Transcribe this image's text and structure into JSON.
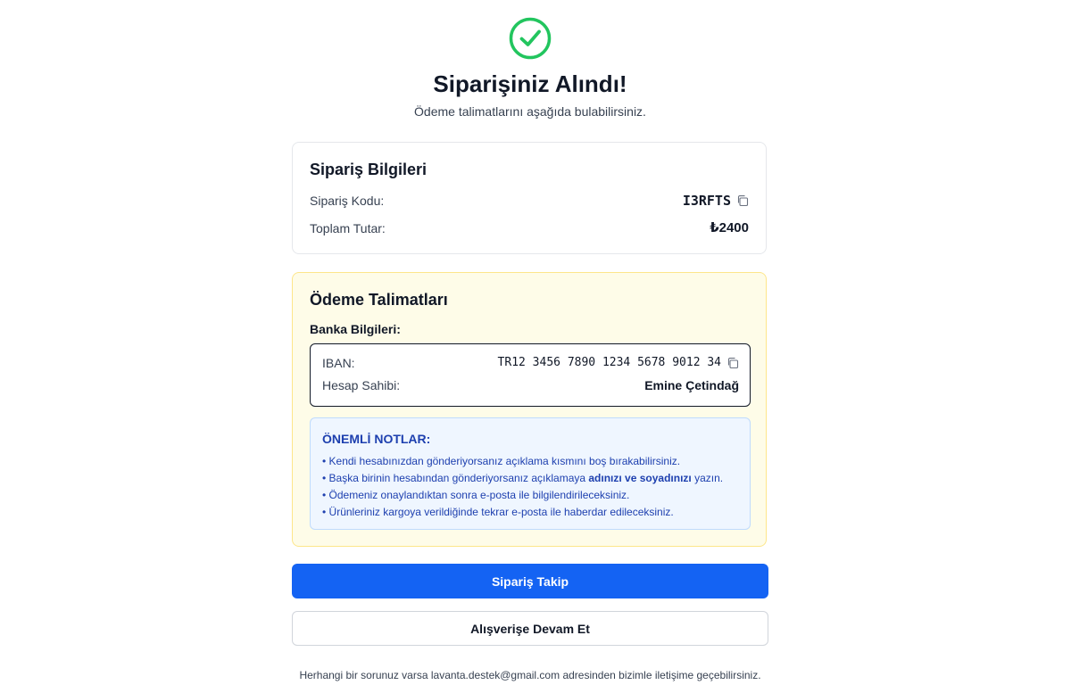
{
  "header": {
    "icon": "check-circle-icon",
    "title": "Siparişiniz Alındı!",
    "subtitle": "Ödeme talimatlarını aşağıda bulabilirsiniz."
  },
  "order_info": {
    "title": "Sipariş Bilgileri",
    "code_label": "Sipariş Kodu:",
    "code_value": "I3RFTS",
    "total_label": "Toplam Tutar:",
    "total_value": "₺2400"
  },
  "payment": {
    "title": "Ödeme Talimatları",
    "bank_label": "Banka Bilgileri:",
    "iban_label": "IBAN:",
    "iban_value": "TR12 3456 7890 1234 5678 9012 34",
    "holder_label": "Hesap Sahibi:",
    "holder_value": "Emine Çetindağ"
  },
  "notes": {
    "title": "ÖNEMLİ NOTLAR:",
    "items": [
      "• Kendi hesabınızdan gönderiyorsanız açıklama kısmını boş bırakabilirsiniz.",
      "• Başka birinin hesabından gönderiyorsanız açıklamaya ",
      "adınızı ve soyadınızı",
      " yazın.",
      "• Ödemeniz onaylandıktan sonra e-posta ile bilgilendirileceksiniz.",
      "• Ürünleriniz kargoya verildiğinde tekrar e-posta ile haberdar edileceksiniz."
    ]
  },
  "actions": {
    "track_label": "Sipariş Takip",
    "continue_label": "Alışverişe Devam Et"
  },
  "footer": {
    "text": "Herhangi bir sorunuz varsa lavanta.destek@gmail.com adresinden bizimle iletişime geçebilirsiniz."
  },
  "colors": {
    "accent": "#1463f3",
    "success": "#22c55e",
    "notes_text": "#1e40af",
    "payment_bg": "#fefce8"
  }
}
